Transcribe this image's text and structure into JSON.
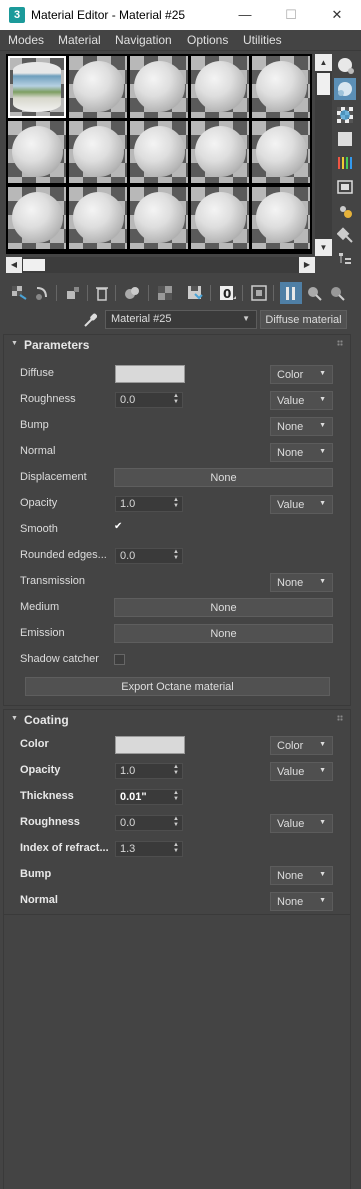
{
  "window": {
    "title": "Material Editor - Material #25",
    "app_icon": "3",
    "minimize": "—",
    "maximize": "☐",
    "close": "✕"
  },
  "menu": [
    "Modes",
    "Material",
    "Navigation",
    "Options",
    "Utilities"
  ],
  "name_row": {
    "material_name": "Material #25",
    "material_type": "Diffuse material"
  },
  "parameters": {
    "title": "Parameters",
    "diffuse": {
      "label": "Diffuse",
      "swatch_color": "#d9d9d9",
      "mode": "Color"
    },
    "roughness": {
      "label": "Roughness",
      "value": "0.0",
      "mode": "Value"
    },
    "bump": {
      "label": "Bump",
      "mode": "None"
    },
    "normal": {
      "label": "Normal",
      "mode": "None"
    },
    "displacement": {
      "label": "Displacement",
      "button": "None"
    },
    "opacity": {
      "label": "Opacity",
      "value": "1.0",
      "mode": "Value"
    },
    "smooth": {
      "label": "Smooth",
      "checked": "✔"
    },
    "rounded_edges": {
      "label": "Rounded edges...",
      "value": "0.0"
    },
    "transmission": {
      "label": "Transmission",
      "mode": "None"
    },
    "medium": {
      "label": "Medium",
      "button": "None"
    },
    "emission": {
      "label": "Emission",
      "button": "None"
    },
    "shadow_catcher": {
      "label": "Shadow catcher",
      "checked": ""
    },
    "export_button": "Export Octane material"
  },
  "coating": {
    "title": "Coating",
    "color": {
      "label": "Color",
      "swatch_color": "#d9d9d9",
      "mode": "Color"
    },
    "opacity": {
      "label": "Opacity",
      "value": "1.0",
      "mode": "Value"
    },
    "thickness": {
      "label": "Thickness",
      "value": "0.01\""
    },
    "roughness": {
      "label": "Roughness",
      "value": "0.0",
      "mode": "Value"
    },
    "ior": {
      "label": "Index of refract...",
      "value": "1.3"
    },
    "bump": {
      "label": "Bump",
      "mode": "None"
    },
    "normal": {
      "label": "Normal",
      "mode": "None"
    }
  },
  "colors": {
    "panel_bg": "#444444",
    "accent": "#5b8fb6",
    "window_bg": "#ffffff"
  }
}
